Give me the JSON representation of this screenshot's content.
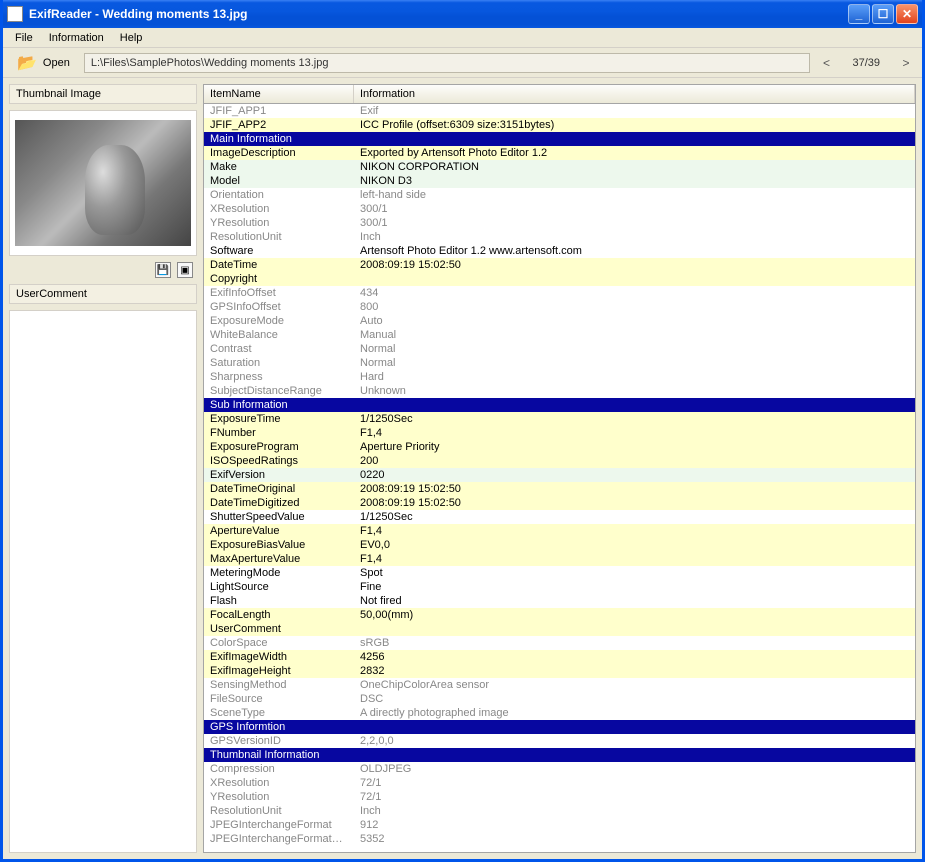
{
  "app": {
    "title": "ExifReader - Wedding moments 13.jpg"
  },
  "menu": {
    "file": "File",
    "information": "Information",
    "help": "Help"
  },
  "toolbar": {
    "open_label": "Open",
    "path": "L:\\Files\\SamplePhotos\\Wedding moments 13.jpg",
    "counter": "37/39"
  },
  "left": {
    "thumb_title": "Thumbnail Image",
    "comment_title": "UserComment"
  },
  "grid": {
    "col_name": "ItemName",
    "col_info": "Information"
  },
  "rows": [
    {
      "style": "grey",
      "name": "JFIF_APP1",
      "info": "Exif"
    },
    {
      "style": "yellow",
      "name": "JFIF_APP2",
      "info": "ICC Profile (offset:6309 size:3151bytes)"
    },
    {
      "style": "header",
      "name": "Main Information",
      "info": ""
    },
    {
      "style": "yellow",
      "name": "ImageDescription",
      "info": "Exported by Artensoft Photo Editor 1.2"
    },
    {
      "style": "green",
      "name": "Make",
      "info": "NIKON CORPORATION"
    },
    {
      "style": "green",
      "name": "Model",
      "info": "NIKON D3"
    },
    {
      "style": "grey",
      "name": "Orientation",
      "info": "left-hand side"
    },
    {
      "style": "grey",
      "name": "XResolution",
      "info": "300/1"
    },
    {
      "style": "grey",
      "name": "YResolution",
      "info": "300/1"
    },
    {
      "style": "grey",
      "name": "ResolutionUnit",
      "info": "Inch"
    },
    {
      "style": "black",
      "name": "Software",
      "info": "Artensoft Photo Editor 1.2  www.artensoft.com"
    },
    {
      "style": "yellow",
      "name": "DateTime",
      "info": "2008:09:19 15:02:50"
    },
    {
      "style": "yellow",
      "name": "Copyright",
      "info": ""
    },
    {
      "style": "grey",
      "name": "ExifInfoOffset",
      "info": "434"
    },
    {
      "style": "grey",
      "name": "GPSInfoOffset",
      "info": "800"
    },
    {
      "style": "grey",
      "name": "ExposureMode",
      "info": "Auto"
    },
    {
      "style": "grey",
      "name": "WhiteBalance",
      "info": "Manual"
    },
    {
      "style": "grey",
      "name": "Contrast",
      "info": "Normal"
    },
    {
      "style": "grey",
      "name": "Saturation",
      "info": "Normal"
    },
    {
      "style": "grey",
      "name": "Sharpness",
      "info": "Hard"
    },
    {
      "style": "grey",
      "name": "SubjectDistanceRange",
      "info": "Unknown"
    },
    {
      "style": "header",
      "name": "Sub Information",
      "info": ""
    },
    {
      "style": "yellow",
      "name": "ExposureTime",
      "info": "1/1250Sec"
    },
    {
      "style": "yellow",
      "name": "FNumber",
      "info": "F1,4"
    },
    {
      "style": "yellow",
      "name": "ExposureProgram",
      "info": "Aperture Priority"
    },
    {
      "style": "yellow",
      "name": "ISOSpeedRatings",
      "info": "200"
    },
    {
      "style": "green",
      "name": "ExifVersion",
      "info": "0220"
    },
    {
      "style": "yellow",
      "name": "DateTimeOriginal",
      "info": "2008:09:19 15:02:50"
    },
    {
      "style": "yellow",
      "name": "DateTimeDigitized",
      "info": "2008:09:19 15:02:50"
    },
    {
      "style": "black",
      "name": "ShutterSpeedValue",
      "info": "1/1250Sec"
    },
    {
      "style": "yellow",
      "name": "ApertureValue",
      "info": "F1,4"
    },
    {
      "style": "yellow",
      "name": "ExposureBiasValue",
      "info": "EV0,0"
    },
    {
      "style": "yellow",
      "name": "MaxApertureValue",
      "info": "F1,4"
    },
    {
      "style": "black",
      "name": "MeteringMode",
      "info": "Spot"
    },
    {
      "style": "black",
      "name": "LightSource",
      "info": "Fine"
    },
    {
      "style": "black",
      "name": "Flash",
      "info": "Not fired"
    },
    {
      "style": "yellow",
      "name": "FocalLength",
      "info": "50,00(mm)"
    },
    {
      "style": "yellow",
      "name": "UserComment",
      "info": ""
    },
    {
      "style": "grey",
      "name": "ColorSpace",
      "info": "sRGB"
    },
    {
      "style": "yellow",
      "name": "ExifImageWidth",
      "info": "4256"
    },
    {
      "style": "yellow",
      "name": "ExifImageHeight",
      "info": "2832"
    },
    {
      "style": "grey",
      "name": "SensingMethod",
      "info": "OneChipColorArea sensor"
    },
    {
      "style": "grey",
      "name": "FileSource",
      "info": "DSC"
    },
    {
      "style": "grey",
      "name": "SceneType",
      "info": "A directly photographed image"
    },
    {
      "style": "header",
      "name": "GPS Informtion",
      "info": ""
    },
    {
      "style": "grey",
      "name": "GPSVersionID",
      "info": "2,2,0,0"
    },
    {
      "style": "header",
      "name": "Thumbnail Information",
      "info": ""
    },
    {
      "style": "grey",
      "name": "Compression",
      "info": "OLDJPEG"
    },
    {
      "style": "grey",
      "name": "XResolution",
      "info": "72/1"
    },
    {
      "style": "grey",
      "name": "YResolution",
      "info": "72/1"
    },
    {
      "style": "grey",
      "name": "ResolutionUnit",
      "info": "Inch"
    },
    {
      "style": "grey",
      "name": "JPEGInterchangeFormat",
      "info": "912"
    },
    {
      "style": "grey",
      "name": "JPEGInterchangeFormatLen...",
      "info": "5352"
    }
  ]
}
